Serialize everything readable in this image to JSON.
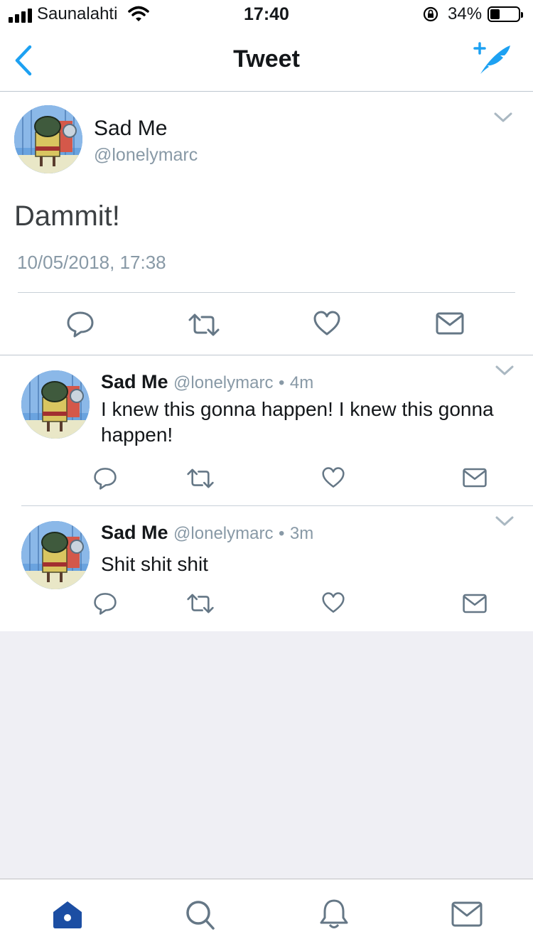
{
  "status_bar": {
    "carrier": "Saunalahti",
    "time": "17:40",
    "battery_pct": "34%",
    "battery_level": 0.34
  },
  "nav": {
    "title": "Tweet",
    "back_icon": "chevron-left-icon",
    "compose_icon": "compose-tweet-icon"
  },
  "main_tweet": {
    "name": "Sad Me",
    "handle": "@lonelymarc",
    "text": "Dammit!",
    "timestamp": "10/05/2018, 17:38"
  },
  "replies": [
    {
      "name": "Sad Me",
      "handle": "@lonelymarc",
      "age": "4m",
      "text": "I knew this gonna happen! I knew this gonna happen!"
    },
    {
      "name": "Sad Me",
      "handle": "@lonelymarc",
      "age": "3m",
      "text": "Shit shit shit"
    }
  ],
  "separator": "•",
  "tabbar": {
    "items": [
      "home-icon",
      "search-icon",
      "notifications-icon",
      "messages-icon"
    ],
    "active": "home-icon"
  },
  "colors": {
    "accent": "#1da1f2",
    "icon_gray": "#657786",
    "secondary_text": "#8899a6",
    "tab_active": "#1c4ea3"
  }
}
